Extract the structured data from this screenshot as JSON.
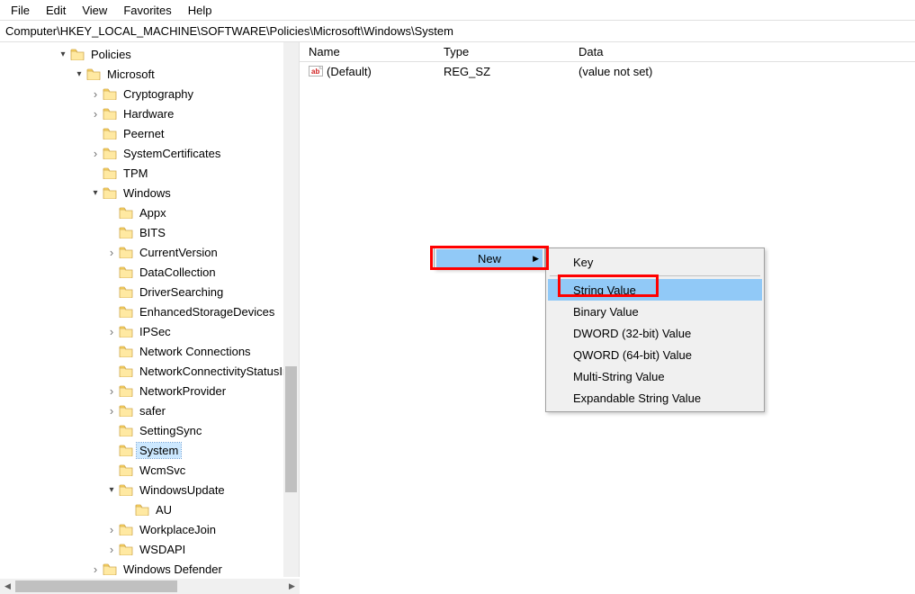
{
  "menubar": [
    "File",
    "Edit",
    "View",
    "Favorites",
    "Help"
  ],
  "address": "Computer\\HKEY_LOCAL_MACHINE\\SOFTWARE\\Policies\\Microsoft\\Windows\\System",
  "list": {
    "columns": [
      "Name",
      "Type",
      "Data"
    ],
    "rows": [
      {
        "name": "(Default)",
        "type": "REG_SZ",
        "data": "(value not set)"
      }
    ]
  },
  "tree": [
    {
      "depth": 3,
      "label": "Policies",
      "expanded": true,
      "hasChildren": true
    },
    {
      "depth": 4,
      "label": "Microsoft",
      "expanded": true,
      "hasChildren": true
    },
    {
      "depth": 5,
      "label": "Cryptography",
      "expanded": false,
      "hasChildren": true
    },
    {
      "depth": 5,
      "label": "Hardware",
      "expanded": false,
      "hasChildren": true
    },
    {
      "depth": 5,
      "label": "Peernet",
      "expanded": false,
      "hasChildren": false
    },
    {
      "depth": 5,
      "label": "SystemCertificates",
      "expanded": false,
      "hasChildren": true
    },
    {
      "depth": 5,
      "label": "TPM",
      "expanded": false,
      "hasChildren": false
    },
    {
      "depth": 5,
      "label": "Windows",
      "expanded": true,
      "hasChildren": true
    },
    {
      "depth": 6,
      "label": "Appx",
      "expanded": false,
      "hasChildren": false
    },
    {
      "depth": 6,
      "label": "BITS",
      "expanded": false,
      "hasChildren": false
    },
    {
      "depth": 6,
      "label": "CurrentVersion",
      "expanded": false,
      "hasChildren": true
    },
    {
      "depth": 6,
      "label": "DataCollection",
      "expanded": false,
      "hasChildren": false
    },
    {
      "depth": 6,
      "label": "DriverSearching",
      "expanded": false,
      "hasChildren": false
    },
    {
      "depth": 6,
      "label": "EnhancedStorageDevices",
      "expanded": false,
      "hasChildren": false
    },
    {
      "depth": 6,
      "label": "IPSec",
      "expanded": false,
      "hasChildren": true
    },
    {
      "depth": 6,
      "label": "Network Connections",
      "expanded": false,
      "hasChildren": false
    },
    {
      "depth": 6,
      "label": "NetworkConnectivityStatusIndicator",
      "expanded": false,
      "hasChildren": false
    },
    {
      "depth": 6,
      "label": "NetworkProvider",
      "expanded": false,
      "hasChildren": true
    },
    {
      "depth": 6,
      "label": "safer",
      "expanded": false,
      "hasChildren": true
    },
    {
      "depth": 6,
      "label": "SettingSync",
      "expanded": false,
      "hasChildren": false
    },
    {
      "depth": 6,
      "label": "System",
      "expanded": false,
      "hasChildren": false,
      "selected": true
    },
    {
      "depth": 6,
      "label": "WcmSvc",
      "expanded": false,
      "hasChildren": false
    },
    {
      "depth": 6,
      "label": "WindowsUpdate",
      "expanded": true,
      "hasChildren": true
    },
    {
      "depth": 7,
      "label": "AU",
      "expanded": false,
      "hasChildren": false
    },
    {
      "depth": 6,
      "label": "WorkplaceJoin",
      "expanded": false,
      "hasChildren": true
    },
    {
      "depth": 6,
      "label": "WSDAPI",
      "expanded": false,
      "hasChildren": true
    },
    {
      "depth": 5,
      "label": "Windows Defender",
      "expanded": false,
      "hasChildren": true
    }
  ],
  "context_menu": {
    "parent_label": "New",
    "items": [
      {
        "label": "Key"
      },
      {
        "sep": true
      },
      {
        "label": "String Value",
        "highlight": true
      },
      {
        "label": "Binary Value"
      },
      {
        "label": "DWORD (32-bit) Value"
      },
      {
        "label": "QWORD (64-bit) Value"
      },
      {
        "label": "Multi-String Value"
      },
      {
        "label": "Expandable String Value"
      }
    ]
  }
}
